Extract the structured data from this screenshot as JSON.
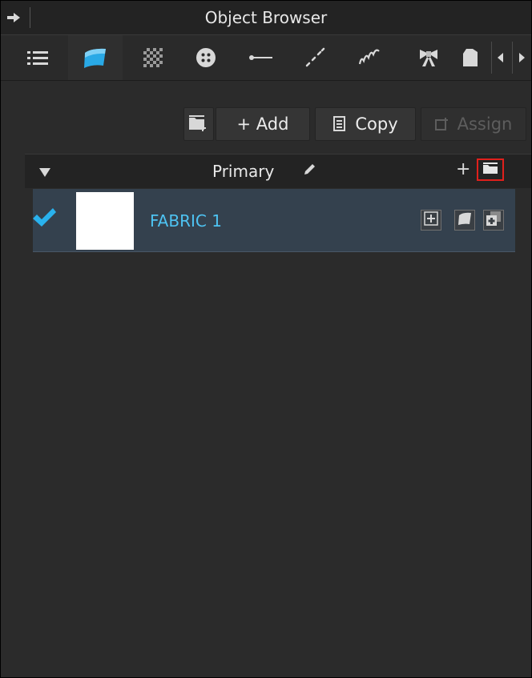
{
  "window": {
    "title": "Object Browser"
  },
  "tabs": [
    {
      "name": "list-tab",
      "icon": "list-icon"
    },
    {
      "name": "fabric-tab",
      "icon": "fabric-icon",
      "active": true
    },
    {
      "name": "texture-tab",
      "icon": "checker-icon"
    },
    {
      "name": "button-tab",
      "icon": "button-icon"
    },
    {
      "name": "line-tab",
      "icon": "line-icon"
    },
    {
      "name": "topstitch-tab",
      "icon": "dashed-line-icon"
    },
    {
      "name": "zigzag-tab",
      "icon": "zigzag-icon"
    },
    {
      "name": "trim-tab",
      "icon": "bow-icon"
    },
    {
      "name": "pattern-tab",
      "icon": "garment-icon"
    }
  ],
  "toolbar": {
    "add_label": "+ Add",
    "copy_label": "Copy",
    "assign_label": "Assign"
  },
  "group": {
    "title": "Primary",
    "add_symbol": "+"
  },
  "fabrics": [
    {
      "name": "FABRIC 1",
      "checked": true,
      "color": "#ffffff"
    }
  ],
  "colors": {
    "accent": "#4ec3f2",
    "highlight": "#e0201c",
    "row_bg": "#34414e"
  }
}
